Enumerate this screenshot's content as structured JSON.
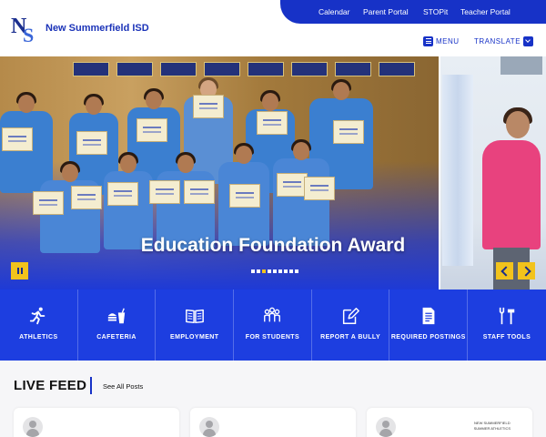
{
  "header": {
    "site_name": "New Summerfield ISD",
    "top_links": [
      "Calendar",
      "Parent Portal",
      "STOPit",
      "Teacher Portal"
    ],
    "menu_label": "MENU",
    "translate_label": "TRANSLATE"
  },
  "hero": {
    "title": "Education Foundation Award",
    "slide_count": 9,
    "active_slide": 2
  },
  "quick_links": [
    {
      "label": "ATHLETICS",
      "icon": "runner-icon"
    },
    {
      "label": "CAFETERIA",
      "icon": "food-icon"
    },
    {
      "label": "EMPLOYMENT",
      "icon": "book-icon"
    },
    {
      "label": "FOR STUDENTS",
      "icon": "group-icon"
    },
    {
      "label": "REPORT A BULLY",
      "icon": "edit-icon"
    },
    {
      "label": "REQUIRED POSTINGS",
      "icon": "document-icon"
    },
    {
      "label": "STAFF TOOLS",
      "icon": "tools-icon"
    }
  ],
  "feed": {
    "title": "LIVE FEED",
    "see_all": "See All Posts",
    "card_text": [
      "NEW SUMMERFIELD",
      "SUMMER ATHLETICS"
    ]
  },
  "colors": {
    "primary": "#1732c7",
    "quicklink_bg": "#1d3ee0",
    "accent": "#f2c31c"
  }
}
